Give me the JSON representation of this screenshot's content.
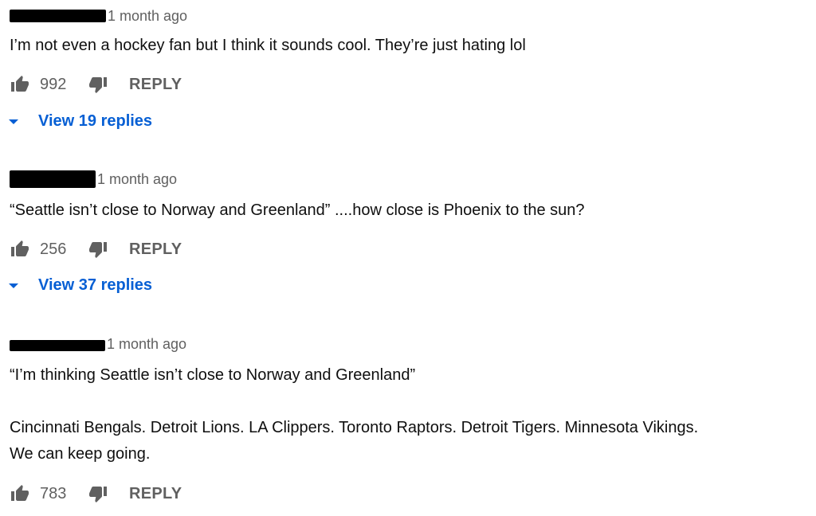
{
  "comments": [
    {
      "time": "1 month ago",
      "text": "I’m not even a hockey fan but I think it sounds cool. They’re just hating lol",
      "likes": "992",
      "reply_label": "REPLY",
      "view_replies_label": "View 19 replies"
    },
    {
      "time": "1 month ago",
      "text": "“Seattle isn’t close to Norway and Greenland” ....how close is Phoenix to the sun?",
      "likes": "256",
      "reply_label": "REPLY",
      "view_replies_label": "View 37 replies"
    },
    {
      "time": "1 month ago",
      "text": "“I’m thinking Seattle isn’t close to Norway and Greenland”\n\nCincinnati Bengals. Detroit Lions. LA Clippers. Toronto Raptors. Detroit Tigers. Minnesota Vikings.\nWe can keep going.",
      "likes": "783",
      "reply_label": "REPLY"
    }
  ],
  "icons": {
    "like": "thumbs-up-icon",
    "dislike": "thumbs-down-icon",
    "expand": "caret-down-icon"
  },
  "colors": {
    "text": "#0f0f0f",
    "secondary": "#606060",
    "link": "#065fd4",
    "redaction": "#000000"
  }
}
